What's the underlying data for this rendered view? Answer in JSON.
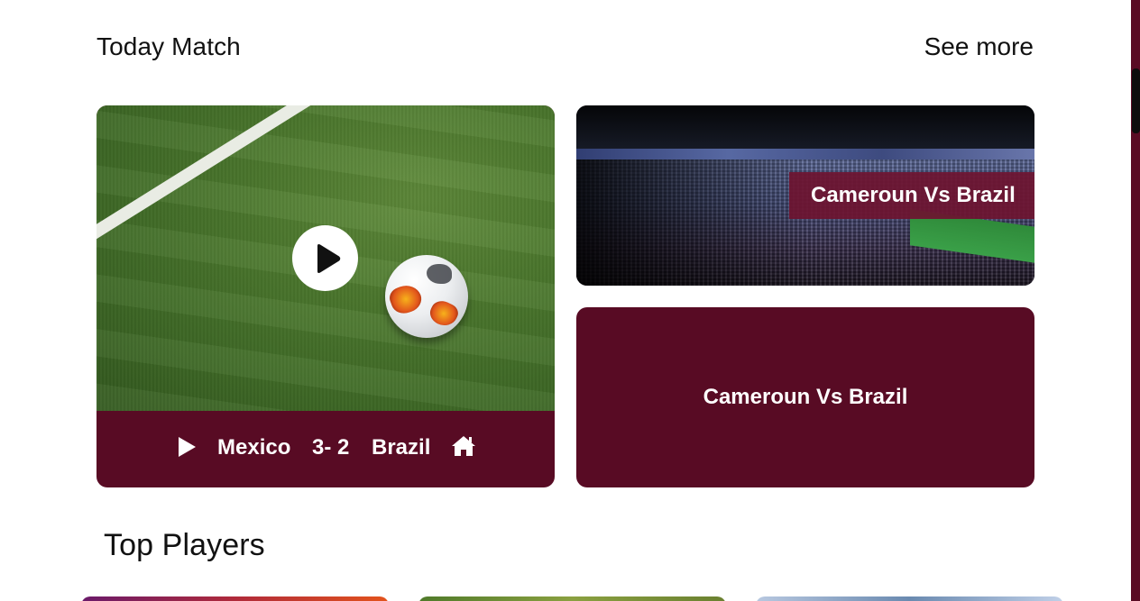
{
  "sections": {
    "today_match_title": "Today Match",
    "see_more_label": "See more",
    "top_players_title": "Top Players"
  },
  "main_match": {
    "team_a": "Mexico",
    "score": "3- 2",
    "team_b": "Brazil"
  },
  "featured_match": {
    "label": "Cameroun Vs Brazil"
  },
  "second_match": {
    "label": "Cameroun Vs Brazil"
  },
  "colors": {
    "brand": "#580b24",
    "white": "#ffffff"
  },
  "icons": [
    "play-icon",
    "home-icon"
  ]
}
